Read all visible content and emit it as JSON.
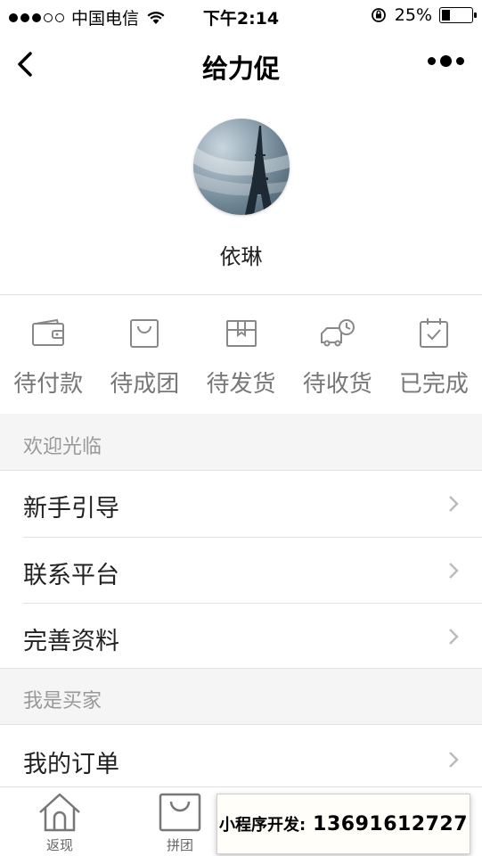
{
  "status_bar": {
    "carrier": "中国电信",
    "time": "下午2:14",
    "battery": "25%",
    "battery_level": 0.25
  },
  "nav": {
    "title": "给力促"
  },
  "profile": {
    "name": "依琳"
  },
  "orders": [
    {
      "label": "待付款",
      "icon": "wallet-icon"
    },
    {
      "label": "待成团",
      "icon": "shopping-bag-icon"
    },
    {
      "label": "待发货",
      "icon": "package-icon"
    },
    {
      "label": "待收货",
      "icon": "delivery-truck-icon"
    },
    {
      "label": "已完成",
      "icon": "calendar-check-icon"
    }
  ],
  "sections": [
    {
      "title": "欢迎光临",
      "items": [
        "新手引导",
        "联系平台",
        "完善资料"
      ]
    },
    {
      "title": "我是买家",
      "items": [
        "我的订单"
      ]
    }
  ],
  "tabbar": {
    "tabs": [
      {
        "label": "返现",
        "icon": "home-icon"
      },
      {
        "label": "拼团",
        "icon": "bag-icon"
      }
    ]
  },
  "ad": {
    "prefix": "小程序开发:",
    "phone": "13691612727"
  }
}
